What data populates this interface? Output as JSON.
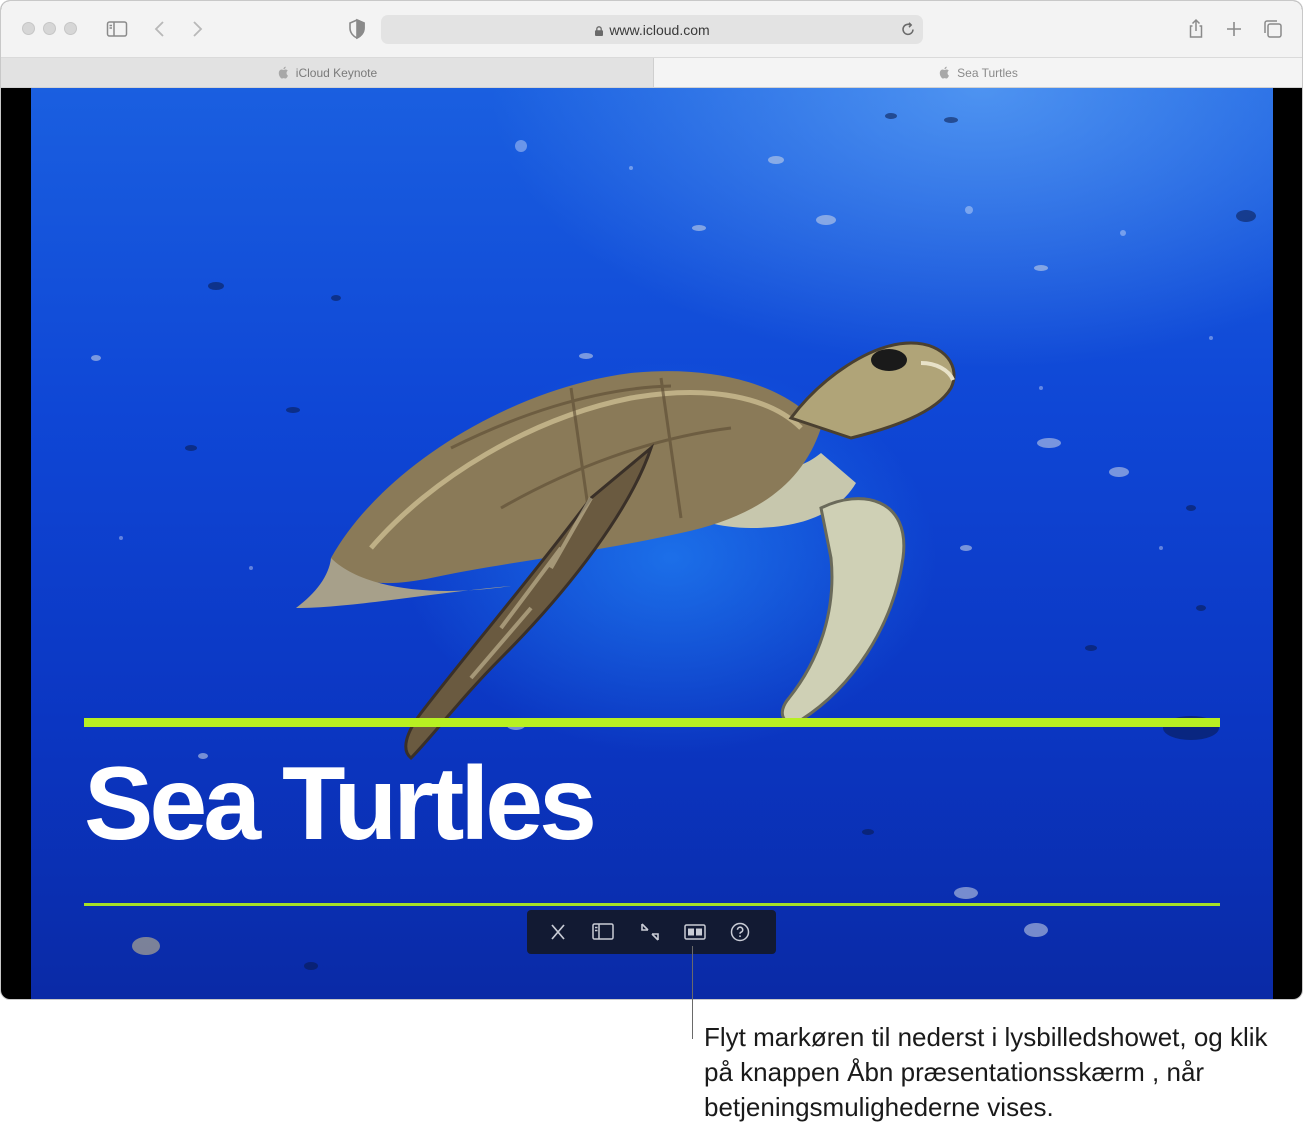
{
  "browser": {
    "url": "www.icloud.com",
    "tabs": [
      {
        "label": "iCloud Keynote"
      },
      {
        "label": "Sea Turtles"
      }
    ],
    "icons": [
      "sidebar-icon",
      "back-icon",
      "forward-icon",
      "privacy-shield-icon",
      "lock-icon",
      "reload-icon",
      "share-icon",
      "new-tab-icon",
      "tab-overview-icon"
    ]
  },
  "slide": {
    "title": "Sea Turtles",
    "accent_color": "#b8f022",
    "background_color": "#1248d2"
  },
  "slideshow_controls": {
    "buttons": [
      "close-icon",
      "sidebar-icon",
      "exit-fullscreen-icon",
      "presenter-display-icon",
      "help-icon"
    ]
  },
  "callout": {
    "text": "Flyt markøren til nederst i lysbilledshowet, og klik på knappen Åbn præsentationsskærm , når betjeningsmulighederne vises."
  }
}
